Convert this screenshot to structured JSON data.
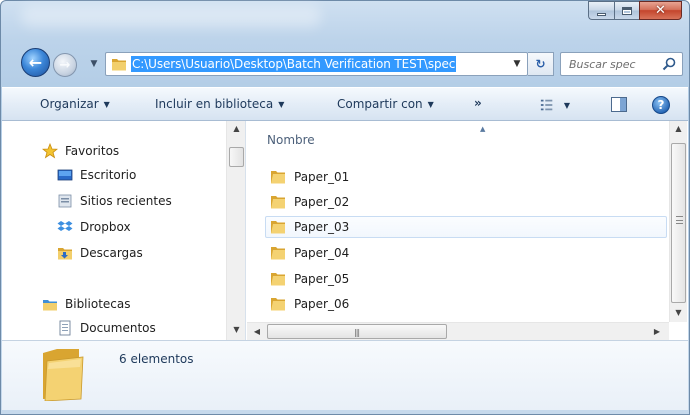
{
  "window": {
    "caption": {
      "minimize": "minimize",
      "maximize": "maximize",
      "close": "close"
    }
  },
  "nav": {
    "back_icon": "back-arrow-icon",
    "forward_icon": "forward-arrow-icon",
    "address_path": "C:\\Users\\Usuario\\Desktop\\Batch Verification TEST\\spec",
    "search_placeholder": "Buscar spec"
  },
  "toolbar": {
    "organize": "Organizar",
    "include_library": "Incluir en biblioteca",
    "share": "Compartir con",
    "more": "»"
  },
  "sidebar": {
    "favorites_label": "Favoritos",
    "favorites": [
      {
        "label": "Escritorio",
        "icon": "desktop-icon"
      },
      {
        "label": "Sitios recientes",
        "icon": "recent-places-icon"
      },
      {
        "label": "Dropbox",
        "icon": "dropbox-icon"
      },
      {
        "label": "Descargas",
        "icon": "downloads-icon"
      }
    ],
    "libraries_label": "Bibliotecas",
    "libraries": [
      {
        "label": "Documentos",
        "icon": "documents-icon"
      }
    ]
  },
  "files": {
    "column_name": "Nombre",
    "items": [
      {
        "name": "Paper_01"
      },
      {
        "name": "Paper_02"
      },
      {
        "name": "Paper_03"
      },
      {
        "name": "Paper_04"
      },
      {
        "name": "Paper_05"
      },
      {
        "name": "Paper_06"
      }
    ],
    "hovered_index": 2
  },
  "details": {
    "count_text": "6 elementos"
  },
  "colors": {
    "selection": "#3399ff",
    "hover_border": "#c8dcf3",
    "toolbar_text": "#1e395b",
    "folder": "#e8b94a"
  }
}
